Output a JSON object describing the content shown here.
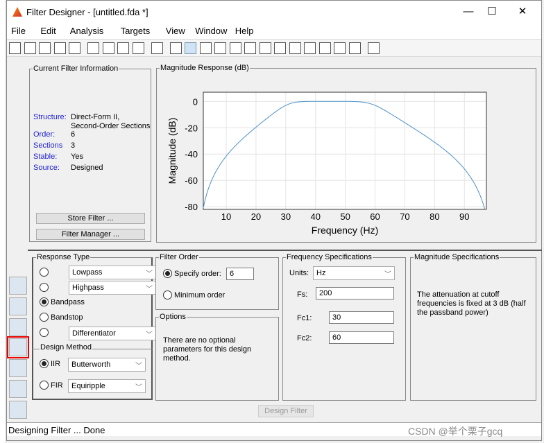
{
  "window": {
    "title": "Filter Designer -  [untitled.fda *]",
    "minimize": "—",
    "maximize": "☐",
    "close": "✕"
  },
  "menu": [
    "File",
    "Edit",
    "Analysis",
    "Targets",
    "View",
    "Window",
    "Help"
  ],
  "toolbar_icons": [
    "new-icon",
    "open-icon",
    "save-icon",
    "print-icon",
    "print-preview-icon",
    "zoom-in-icon",
    "zoom-x-icon",
    "zoom-y-icon",
    "full-view-icon",
    "new-figure-icon",
    "filter-spec-icon",
    "magnitude-icon",
    "phase-icon",
    "mag-phase-icon",
    "group-delay-icon",
    "phase-delay-icon",
    "impulse-icon",
    "step-icon",
    "pole-zero-icon",
    "coefficients-icon",
    "info-icon",
    "magnitude-estimate-icon",
    "round-off-noise-icon",
    "whats-this-icon"
  ],
  "filter_info": {
    "legend": "Current Filter Information",
    "rows": [
      {
        "k": "Structure:",
        "v": "Direct-Form II,\nSecond-Order Sections"
      },
      {
        "k": "Order:",
        "v": "6"
      },
      {
        "k": "Sections",
        "v": "3"
      },
      {
        "k": "Stable:",
        "v": "Yes"
      },
      {
        "k": "Source:",
        "v": "Designed"
      }
    ],
    "store": "Store Filter ...",
    "manager": "Filter Manager ..."
  },
  "chart_data": {
    "type": "line",
    "title": "Magnitude Response (dB)",
    "xlabel": "Frequency (Hz)",
    "ylabel": "Magnitude (dB)",
    "xlim": [
      2.3,
      97.4
    ],
    "ylim": [
      -82,
      7
    ],
    "xticks": [
      10,
      20,
      30,
      40,
      50,
      60,
      70,
      80,
      90
    ],
    "yticks": [
      0,
      -20,
      -40,
      -60,
      -80
    ],
    "grid": true,
    "color": "#4a90c8",
    "x": [
      2.5,
      5,
      10,
      20,
      30,
      45,
      60,
      70,
      80,
      90,
      95,
      97
    ],
    "y": [
      -78.8,
      -60.5,
      -41.5,
      -19.6,
      -3,
      0,
      -3,
      -16.2,
      -31,
      -51.3,
      -69.8,
      -83
    ]
  },
  "response_type": {
    "legend": "Response Type",
    "lowpass": "Lowpass",
    "highpass": "Highpass",
    "bandpass": "Bandpass",
    "bandstop": "Bandstop",
    "differentiator": "Differentiator",
    "selected": "Bandpass"
  },
  "design_method": {
    "legend": "Design Method",
    "iir": "IIR",
    "iir_type": "Butterworth",
    "fir": "FIR",
    "fir_type": "Equiripple",
    "selected": "IIR"
  },
  "filter_order": {
    "legend": "Filter Order",
    "specify": "Specify order:",
    "order": "6",
    "minimum": "Minimum order"
  },
  "options": {
    "legend": "Options",
    "text": "There are no optional parameters for this design method."
  },
  "freq": {
    "legend": "Frequency Specifications",
    "units_label": "Units:",
    "units": "Hz",
    "fs_label": "Fs:",
    "fs": "200",
    "fc1_label": "Fc1:",
    "fc1": "30",
    "fc2_label": "Fc2:",
    "fc2": "60"
  },
  "mag": {
    "legend": "Magnitude Specifications",
    "text": "The attenuation at cutoff frequencies is fixed at 3 dB (half the passband power)"
  },
  "design_button": "Design Filter",
  "status": "Designing Filter ... Done",
  "watermark": "CSDN @举个栗子gcq",
  "side_icons": [
    "transform-filter-icon",
    "realize-model-icon",
    "design-filter-icon",
    "pole-zero-editor-icon",
    "import-filter-icon",
    "multirate-icon",
    "quantize-icon"
  ]
}
